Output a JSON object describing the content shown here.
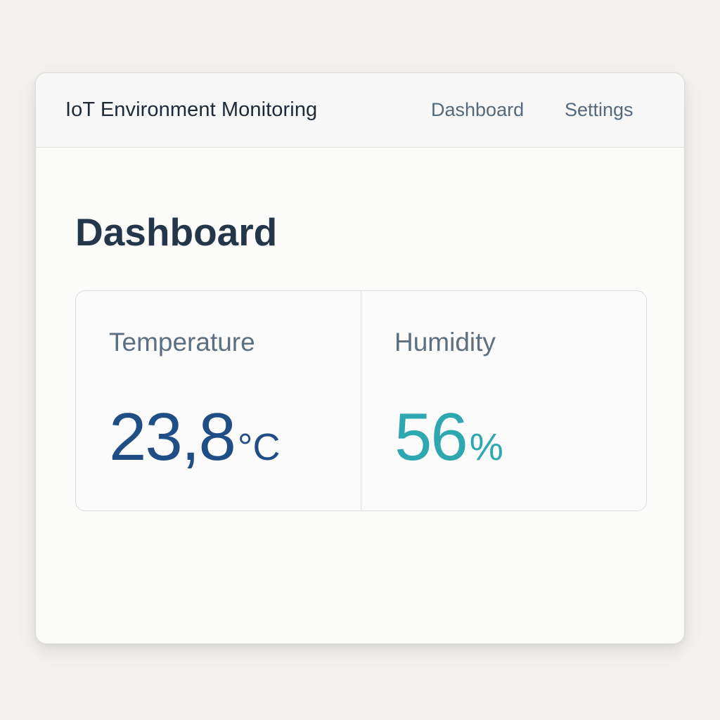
{
  "app": {
    "title": "IoT Environment Monitoring"
  },
  "nav": {
    "items": [
      {
        "label": "Dashboard"
      },
      {
        "label": "Settings"
      }
    ]
  },
  "page": {
    "title": "Dashboard"
  },
  "metrics": {
    "temperature": {
      "label": "Temperature",
      "value": "23,8",
      "unit": "°C",
      "color": "#1f4e86"
    },
    "humidity": {
      "label": "Humidity",
      "value": "56",
      "unit": "%",
      "color": "#2ea8b0"
    }
  }
}
